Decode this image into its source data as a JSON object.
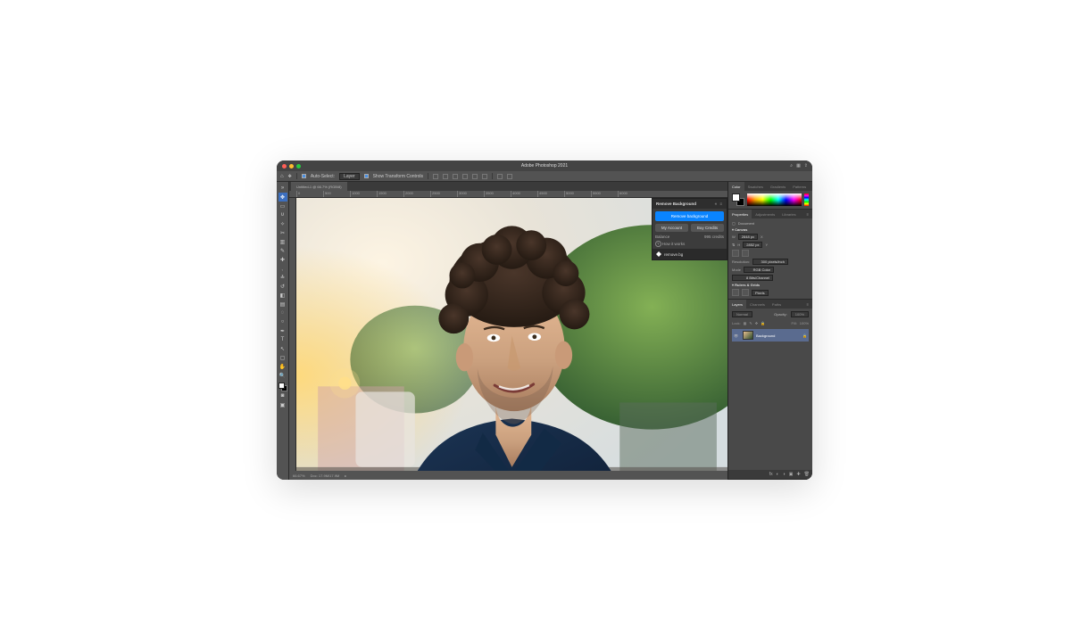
{
  "app": {
    "title": "Adobe Photoshop 2021"
  },
  "titlebar_icons": [
    "search",
    "workspace",
    "share"
  ],
  "options": {
    "auto_select_label": "Auto-Select:",
    "auto_select_value": "Layer",
    "transform_label": "Show Transform Controls"
  },
  "document": {
    "tab_label": "Untitled-1 @ 66.7% (RGB/8)",
    "zoom": "66.67%",
    "status": "Doc: 17.9M/17.9M"
  },
  "ruler_ticks": [
    "0",
    "500",
    "1000",
    "1500",
    "2000",
    "2500",
    "3000",
    "3500",
    "4000",
    "4500",
    "5000",
    "5500",
    "6000"
  ],
  "tools": [
    {
      "name": "move",
      "glyph": "✥",
      "selected": true
    },
    {
      "name": "marquee",
      "glyph": "▭"
    },
    {
      "name": "lasso",
      "glyph": "ʋ"
    },
    {
      "name": "wand",
      "glyph": "✧"
    },
    {
      "name": "crop",
      "glyph": "✂"
    },
    {
      "name": "frame",
      "glyph": "▥"
    },
    {
      "name": "eyedropper",
      "glyph": "✎"
    },
    {
      "name": "heal",
      "glyph": "✚"
    },
    {
      "name": "brush",
      "glyph": "ˎ"
    },
    {
      "name": "stamp",
      "glyph": "≛"
    },
    {
      "name": "history",
      "glyph": "↺"
    },
    {
      "name": "eraser",
      "glyph": "◧"
    },
    {
      "name": "gradient",
      "glyph": "▤"
    },
    {
      "name": "blur",
      "glyph": "◌"
    },
    {
      "name": "dodge",
      "glyph": "○"
    },
    {
      "name": "pen",
      "glyph": "✒"
    },
    {
      "name": "type",
      "glyph": "T"
    },
    {
      "name": "path",
      "glyph": "↖"
    },
    {
      "name": "shape",
      "glyph": "▢"
    },
    {
      "name": "hand",
      "glyph": "✋"
    },
    {
      "name": "zoom",
      "glyph": "🔍"
    }
  ],
  "plugin": {
    "title": "Remove Background",
    "primary": "Remove background",
    "account": "My Account",
    "buy": "Buy Credits",
    "balance_label": "Balance",
    "balance_value": "995 credits",
    "help": "How it works",
    "brand": "remove.bg"
  },
  "color_panel": {
    "tabs": [
      "Color",
      "Swatches",
      "Gradients",
      "Patterns"
    ],
    "active": 0
  },
  "properties": {
    "tabs": [
      "Properties",
      "Adjustments",
      "Libraries"
    ],
    "active": 0,
    "doc_label": "Document",
    "canvas_label": "Canvas",
    "width_label": "W",
    "width_value": "2848 px",
    "x_label": "X",
    "height_label": "H",
    "height_value": "2852 px",
    "y_label": "Y",
    "res_label": "Resolution:",
    "res_value": "300 pixels/inch",
    "mode_label": "Mode",
    "mode_value": "RGB Color",
    "depth_value": "8 Bits/Channel",
    "rulers_label": "Rulers & Grids",
    "units_value": "Pixels"
  },
  "layers": {
    "tabs": [
      "Layers",
      "Channels",
      "Paths"
    ],
    "active": 0,
    "blend_mode": "Normal",
    "opacity_label": "Opacity:",
    "opacity_value": "100%",
    "lock_label": "Lock:",
    "fill_label": "Fill:",
    "fill_value": "100%",
    "layer_name": "Background"
  }
}
